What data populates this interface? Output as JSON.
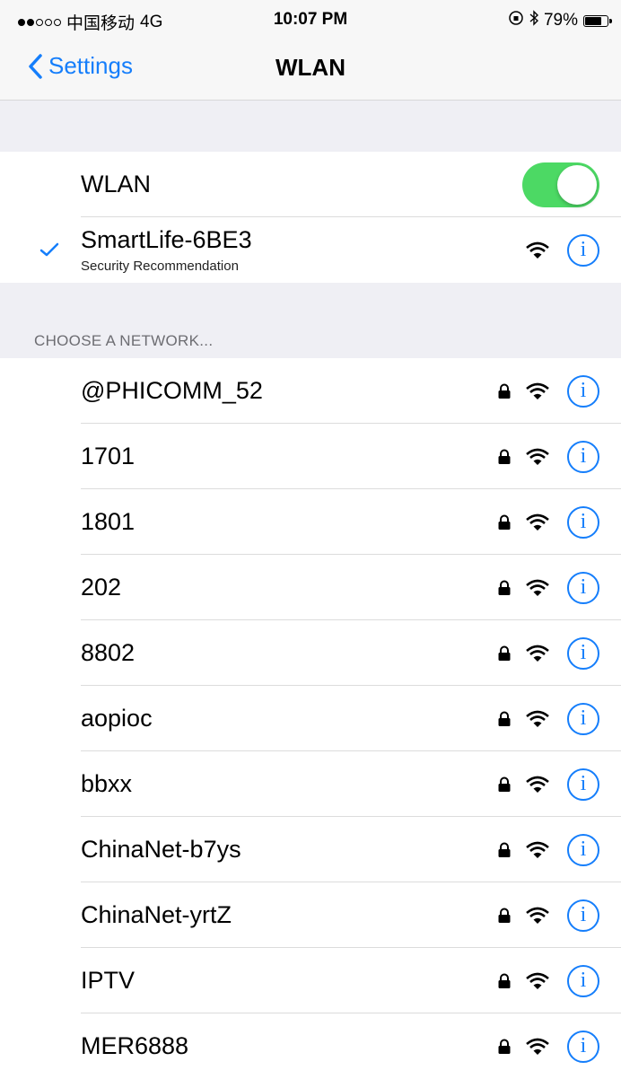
{
  "status_bar": {
    "carrier": "中国移动",
    "network": "4G",
    "time": "10:07 PM",
    "battery_percent": "79%",
    "battery_level": 0.79
  },
  "nav": {
    "back_label": "Settings",
    "title": "WLAN"
  },
  "wlan": {
    "label": "WLAN",
    "enabled": true
  },
  "connected": {
    "name": "SmartLife-6BE3",
    "subtitle": "Security Recommendation"
  },
  "section_header": "CHOOSE A NETWORK...",
  "networks": [
    {
      "name": "@PHICOMM_52"
    },
    {
      "name": "1701"
    },
    {
      "name": "1801"
    },
    {
      "name": "202"
    },
    {
      "name": "8802"
    },
    {
      "name": "aopioc"
    },
    {
      "name": "bbxx"
    },
    {
      "name": "ChinaNet-b7ys"
    },
    {
      "name": "ChinaNet-yrtZ"
    },
    {
      "name": "IPTV"
    },
    {
      "name": "MER6888"
    }
  ],
  "colors": {
    "accent": "#157efb",
    "toggle_on": "#4cd964",
    "background": "#efeff4"
  },
  "icons": {
    "lock": "lock-icon",
    "wifi": "wifi-icon",
    "info": "info-icon",
    "check": "checkmark-icon",
    "back": "chevron-left-icon"
  }
}
